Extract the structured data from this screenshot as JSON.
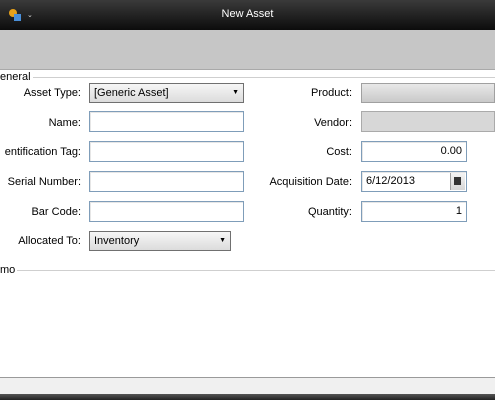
{
  "window": {
    "title": "New Asset",
    "app_icon": "asset-app-icon",
    "menu_caret": "⌄"
  },
  "general_section": {
    "legend": "eneral",
    "asset_type": {
      "label": "Asset Type:",
      "value": "[Generic Asset]"
    },
    "name": {
      "label": "Name:",
      "value": ""
    },
    "identification_tag": {
      "label": "entification Tag:",
      "value": ""
    },
    "serial_number": {
      "label": "Serial Number:",
      "value": ""
    },
    "bar_code": {
      "label": "Bar Code:",
      "value": ""
    },
    "allocated_to": {
      "label": "Allocated To:",
      "value": "Inventory"
    },
    "product": {
      "label": "Product:",
      "value": ""
    },
    "vendor": {
      "label": "Vendor:",
      "value": ""
    },
    "cost": {
      "label": "Cost:",
      "value": "0.00"
    },
    "acquisition_date": {
      "label": "Acquisition Date:",
      "value": "6/12/2013"
    },
    "quantity": {
      "label": "Quantity:",
      "value": "1"
    }
  },
  "memo_section": {
    "legend": "mo",
    "value": ""
  },
  "colors": {
    "titlebar": "#1a1a1a",
    "toolbar": "#c6c6c6",
    "input_border": "#7f9db9"
  }
}
